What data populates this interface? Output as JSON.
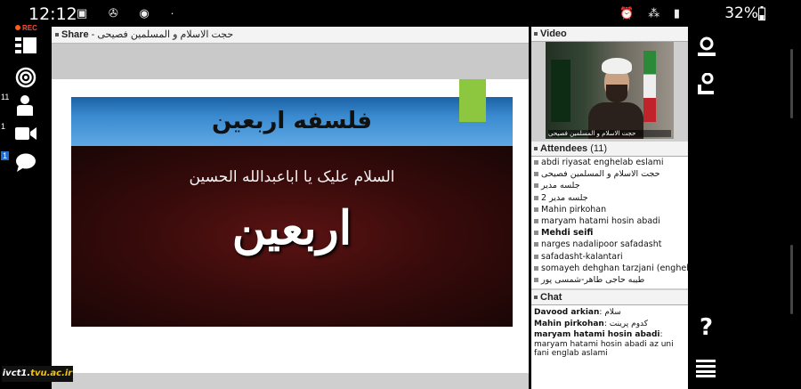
{
  "status_bar": {
    "time": "12:12",
    "battery": "32%"
  },
  "left_toolbar": {
    "rec_label": "REC",
    "attendee_count": "11",
    "camera_count": "1",
    "chat_count": "1"
  },
  "share_pod": {
    "label": "Share",
    "presenter": "- حجت الاسلام و المسلمین فصیحی",
    "slide_title": "فلسفه اربعین",
    "slide_subtitle": "السلام علیک یا اباعبدالله الحسین",
    "slide_calligraphy": "اربعین"
  },
  "watermark": {
    "prefix": "ivct1.",
    "domain": "tvu.ac.ir"
  },
  "video_pod": {
    "label": "Video",
    "caption": "حجت الاسلام و المسلمین فصیحی"
  },
  "attendees_pod": {
    "label": "Attendees",
    "count": "(11)",
    "list": [
      "abdi riyasat enghelab eslami",
      "حجت الاسلام و المسلمین فصیحی",
      "جلسه مدیر",
      "جلسه مدیر 2",
      "Mahin pirkohan",
      "maryam hatami hosin abadi",
      "Mehdi seifi",
      "narges nadalipoor  safadasht",
      "safadasht-kalantari",
      "somayeh dehghan tarzjani (enghelab",
      "طیبه حاجی طاهر-شمسی پور"
    ]
  },
  "chat_pod": {
    "label": "Chat",
    "messages": [
      {
        "sender": "Davood arkian",
        "text": "سلام"
      },
      {
        "sender": "Mahin pirkohan",
        "text": "کدوم پرینت"
      },
      {
        "sender": "maryam hatami hosin abadi",
        "text": "maryam hatami hosin abadi az uni fani englab aslami"
      }
    ]
  },
  "right_toolbar": {
    "help_label": "?"
  }
}
